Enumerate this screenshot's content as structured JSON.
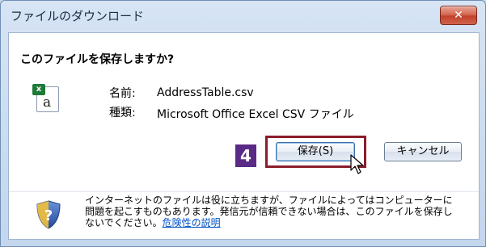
{
  "window": {
    "title": "ファイルのダウンロード",
    "close_label": "✕"
  },
  "dialog": {
    "question": "このファイルを保存しますか?",
    "file": {
      "name_label": "名前:",
      "name_value": "AddressTable.csv",
      "type_label": "種類:",
      "type_value": "Microsoft Office Excel CSV ファイル"
    },
    "step_number": "4",
    "buttons": {
      "save": "保存(S)",
      "cancel": "キャンセル"
    },
    "warning": {
      "text": "インターネットのファイルは役に立ちますが、ファイルによってはコンピューターに問題を起こすものもあります。発信元が信頼できない場合は、このファイルを保存しないでください。",
      "link": "危険性の説明"
    }
  },
  "colors": {
    "frame": "#c9d9ec",
    "badge": "#5a2a87",
    "focus_border": "#8b1d2a",
    "link": "#0050c8"
  },
  "icons": {
    "file": "excel-csv-file-icon",
    "shield": "security-shield-icon",
    "cursor": "mouse-pointer-icon",
    "close": "close-icon"
  }
}
